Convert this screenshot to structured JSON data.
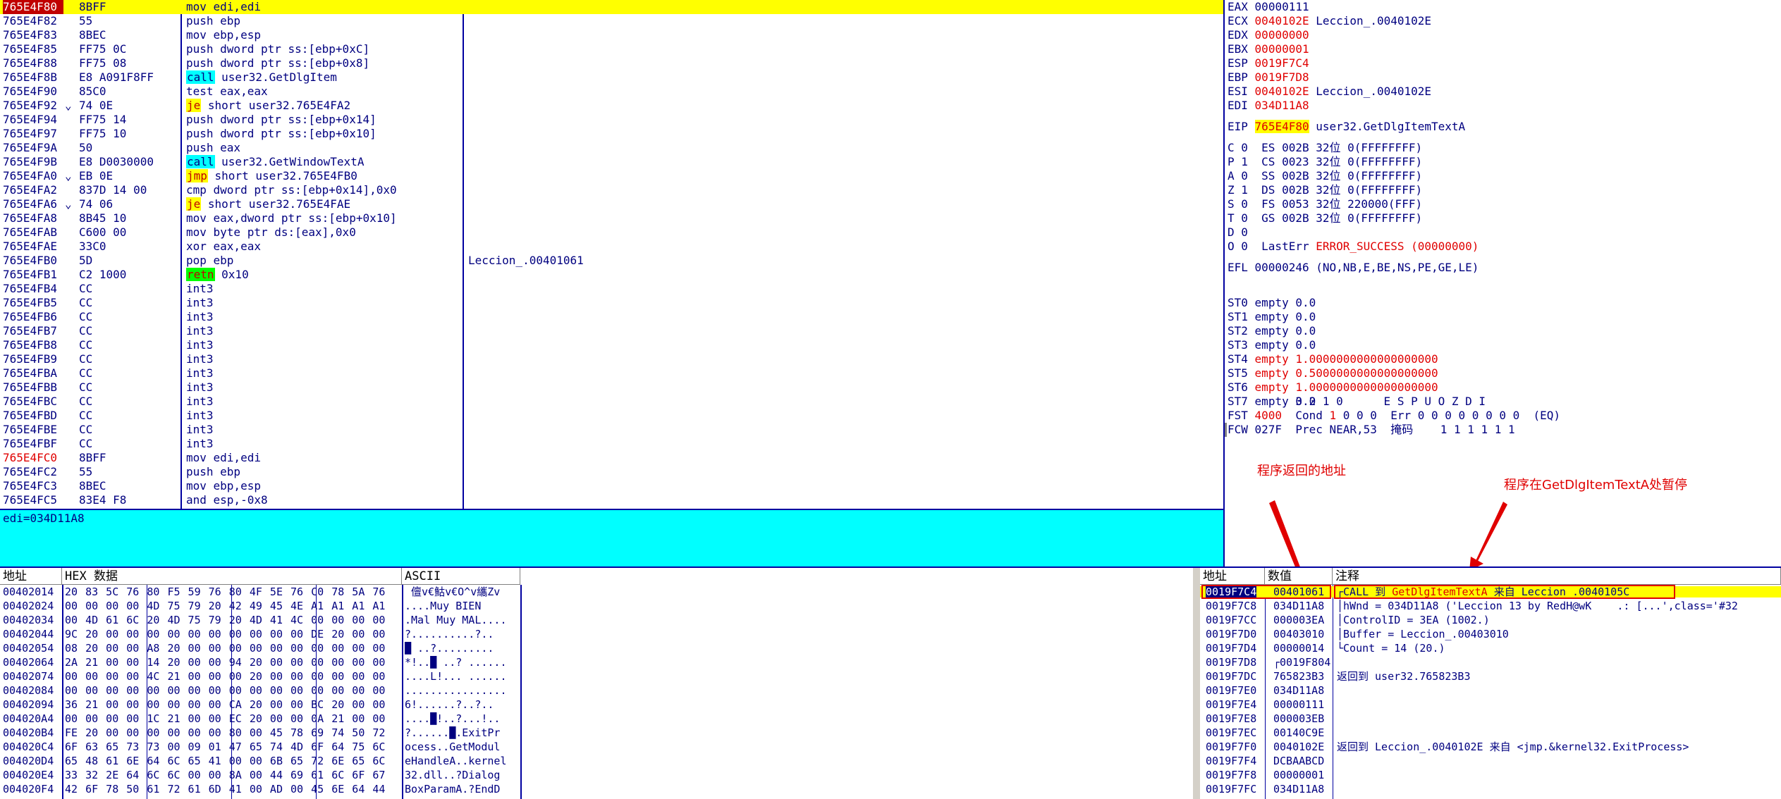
{
  "disasm": {
    "rows": [
      {
        "addr": "765E4F80",
        "arrow": "",
        "hex": "8BFF",
        "ins": "mov edi,edi",
        "kind": "",
        "cmt": "",
        "sel": true,
        "addr_style": "hl"
      },
      {
        "addr": "765E4F82",
        "arrow": "",
        "hex": "55",
        "ins": "push ebp",
        "kind": "",
        "cmt": ""
      },
      {
        "addr": "765E4F83",
        "arrow": "",
        "hex": "8BEC",
        "ins": "mov ebp,esp",
        "kind": "",
        "cmt": ""
      },
      {
        "addr": "765E4F85",
        "arrow": "",
        "hex": "FF75 0C",
        "ins": "push dword ptr ss:[ebp+0xC]",
        "kind": "",
        "cmt": ""
      },
      {
        "addr": "765E4F88",
        "arrow": "",
        "hex": "FF75 08",
        "ins": "push dword ptr ss:[ebp+0x8]",
        "kind": "",
        "cmt": ""
      },
      {
        "addr": "765E4F8B",
        "arrow": "",
        "hex": "E8 A091F8FF",
        "op": "call",
        "ins": " user32.GetDlgItem",
        "kind": "call",
        "cmt": ""
      },
      {
        "addr": "765E4F90",
        "arrow": "",
        "hex": "85C0",
        "ins": "test eax,eax",
        "kind": "",
        "cmt": ""
      },
      {
        "addr": "765E4F92",
        "arrow": "⌄",
        "hex": "74 0E",
        "op": "je",
        "ins": " short user32.765E4FA2",
        "kind": "jcc",
        "cmt": ""
      },
      {
        "addr": "765E4F94",
        "arrow": "",
        "hex": "FF75 14",
        "ins": "push dword ptr ss:[ebp+0x14]",
        "kind": "",
        "cmt": ""
      },
      {
        "addr": "765E4F97",
        "arrow": "",
        "hex": "FF75 10",
        "ins": "push dword ptr ss:[ebp+0x10]",
        "kind": "",
        "cmt": ""
      },
      {
        "addr": "765E4F9A",
        "arrow": "",
        "hex": "50",
        "ins": "push eax",
        "kind": "",
        "cmt": ""
      },
      {
        "addr": "765E4F9B",
        "arrow": "",
        "hex": "E8 D0030000",
        "op": "call",
        "ins": " user32.GetWindowTextA",
        "kind": "call",
        "cmt": ""
      },
      {
        "addr": "765E4FA0",
        "arrow": "⌄",
        "hex": "EB 0E",
        "op": "jmp",
        "ins": " short user32.765E4FB0",
        "kind": "jmp",
        "cmt": ""
      },
      {
        "addr": "765E4FA2",
        "arrow": "",
        "hex": "837D 14 00",
        "ins": "cmp dword ptr ss:[ebp+0x14],0x0",
        "kind": "",
        "cmt": ""
      },
      {
        "addr": "765E4FA6",
        "arrow": "⌄",
        "hex": "74 06",
        "op": "je",
        "ins": " short user32.765E4FAE",
        "kind": "jcc",
        "cmt": ""
      },
      {
        "addr": "765E4FA8",
        "arrow": "",
        "hex": "8B45 10",
        "ins": "mov eax,dword ptr ss:[ebp+0x10]",
        "kind": "",
        "cmt": ""
      },
      {
        "addr": "765E4FAB",
        "arrow": "",
        "hex": "C600 00",
        "ins": "mov byte ptr ds:[eax],0x0",
        "kind": "",
        "cmt": ""
      },
      {
        "addr": "765E4FAE",
        "arrow": "",
        "hex": "33C0",
        "ins": "xor eax,eax",
        "kind": "",
        "cmt": ""
      },
      {
        "addr": "765E4FB0",
        "arrow": "",
        "hex": "5D",
        "ins": "pop ebp",
        "kind": "",
        "cmt": "Leccion_.00401061"
      },
      {
        "addr": "765E4FB1",
        "arrow": "",
        "hex": "C2 1000",
        "op": "retn",
        "ins": " 0x10",
        "kind": "ret",
        "cmt": ""
      },
      {
        "addr": "765E4FB4",
        "arrow": "",
        "hex": "CC",
        "ins": "int3",
        "kind": "",
        "cmt": ""
      },
      {
        "addr": "765E4FB5",
        "arrow": "",
        "hex": "CC",
        "ins": "int3",
        "kind": "",
        "cmt": ""
      },
      {
        "addr": "765E4FB6",
        "arrow": "",
        "hex": "CC",
        "ins": "int3",
        "kind": "",
        "cmt": ""
      },
      {
        "addr": "765E4FB7",
        "arrow": "",
        "hex": "CC",
        "ins": "int3",
        "kind": "",
        "cmt": ""
      },
      {
        "addr": "765E4FB8",
        "arrow": "",
        "hex": "CC",
        "ins": "int3",
        "kind": "",
        "cmt": ""
      },
      {
        "addr": "765E4FB9",
        "arrow": "",
        "hex": "CC",
        "ins": "int3",
        "kind": "",
        "cmt": ""
      },
      {
        "addr": "765E4FBA",
        "arrow": "",
        "hex": "CC",
        "ins": "int3",
        "kind": "",
        "cmt": ""
      },
      {
        "addr": "765E4FBB",
        "arrow": "",
        "hex": "CC",
        "ins": "int3",
        "kind": "",
        "cmt": ""
      },
      {
        "addr": "765E4FBC",
        "arrow": "",
        "hex": "CC",
        "ins": "int3",
        "kind": "",
        "cmt": ""
      },
      {
        "addr": "765E4FBD",
        "arrow": "",
        "hex": "CC",
        "ins": "int3",
        "kind": "",
        "cmt": ""
      },
      {
        "addr": "765E4FBE",
        "arrow": "",
        "hex": "CC",
        "ins": "int3",
        "kind": "",
        "cmt": ""
      },
      {
        "addr": "765E4FBF",
        "arrow": "",
        "hex": "CC",
        "ins": "int3",
        "kind": "",
        "cmt": ""
      },
      {
        "addr": "765E4FC0",
        "arrow": "",
        "hex": "8BFF",
        "ins": "mov edi,edi",
        "kind": "",
        "cmt": "",
        "addr_style": "red"
      },
      {
        "addr": "765E4FC2",
        "arrow": "",
        "hex": "55",
        "ins": "push ebp",
        "kind": "",
        "cmt": ""
      },
      {
        "addr": "765E4FC3",
        "arrow": "",
        "hex": "8BEC",
        "ins": "mov ebp,esp",
        "kind": "",
        "cmt": ""
      },
      {
        "addr": "765E4FC5",
        "arrow": "",
        "hex": "83E4 F8",
        "ins": "and esp,-0x8",
        "kind": "",
        "cmt": ""
      }
    ]
  },
  "infobar": {
    "text": "edi=034D11A8"
  },
  "registers": {
    "gp": [
      {
        "name": "EAX",
        "value": "00000111",
        "cmt": "",
        "red": false
      },
      {
        "name": "ECX",
        "value": "0040102E",
        "cmt": "Leccion_.0040102E",
        "red": true
      },
      {
        "name": "EDX",
        "value": "00000000",
        "cmt": "",
        "red": true
      },
      {
        "name": "EBX",
        "value": "00000001",
        "cmt": "",
        "red": true
      },
      {
        "name": "ESP",
        "value": "0019F7C4",
        "cmt": "",
        "red": true
      },
      {
        "name": "EBP",
        "value": "0019F7D8",
        "cmt": "",
        "red": true
      },
      {
        "name": "ESI",
        "value": "0040102E",
        "cmt": "Leccion_.0040102E",
        "red": true
      },
      {
        "name": "EDI",
        "value": "034D11A8",
        "cmt": "",
        "red": true
      }
    ],
    "eip": {
      "name": "EIP",
      "value": "765E4F80",
      "cmt": "user32.GetDlgItemTextA"
    },
    "flags": [
      "C 0  ES 002B 32位 0(FFFFFFFF)",
      "P 1  CS 0023 32位 0(FFFFFFFF)",
      "A 0  SS 002B 32位 0(FFFFFFFF)",
      "Z 1  DS 002B 32位 0(FFFFFFFF)",
      "S 0  FS 0053 32位 220000(FFF)",
      "T 0  GS 002B 32位 0(FFFFFFFF)",
      "D 0"
    ],
    "lasterr_prefix": "O 0  LastErr ",
    "lasterr_value": "ERROR_SUCCESS (00000000)",
    "efl": "EFL 00000246 (NO,NB,E,BE,NS,PE,GE,LE)",
    "fpu": [
      {
        "name": "ST0",
        "val": "empty 0.0",
        "red": false
      },
      {
        "name": "ST1",
        "val": "empty 0.0",
        "red": false
      },
      {
        "name": "ST2",
        "val": "empty 0.0",
        "red": false
      },
      {
        "name": "ST3",
        "val": "empty 0.0",
        "red": false
      },
      {
        "name": "ST4",
        "val": "empty 1.0000000000000000000",
        "red": true
      },
      {
        "name": "ST5",
        "val": "empty 0.5000000000000000000",
        "red": true
      },
      {
        "name": "ST6",
        "val": "empty 1.0000000000000000000",
        "red": true
      },
      {
        "name": "ST7",
        "val": "empty 0.0",
        "red": false
      }
    ],
    "fpu_bits_header": "          3 2 1 0      E S P U O Z D I",
    "fst_prefix": "FST ",
    "fst_value": "4000",
    "fst_suffix": "  Cond ",
    "fst_cond_red": "1",
    "fst_rest": " 0 0 0  Err 0 0 0 0 0 0 0 0  (EQ)",
    "fcw": "FCW 027F  Prec NEAR,53  掩码    1 1 1 1 1 1"
  },
  "annotations": {
    "return_addr": "程序返回的地址",
    "paused_at": "程序在GetDlgItemTextA处暂停"
  },
  "dump": {
    "headers": {
      "addr": "地址",
      "hex": "HEX 数据",
      "ascii": "ASCII"
    },
    "rows": [
      {
        "addr": "00402014",
        "hex": "20 83 5C 76 80 F5 59 76 80 4F 5E 76 C0 78 5A 76",
        "ascii": " 儃v€鮕v€O^v纗Zv"
      },
      {
        "addr": "00402024",
        "hex": "00 00 00 00 4D 75 79 20 42 49 45 4E A1 A1 A1 A1",
        "ascii": "....Muy BIEN"
      },
      {
        "addr": "00402034",
        "hex": "00 4D 61 6C 20 4D 75 79 20 4D 41 4C 00 00 00 00",
        "ascii": ".Mal Muy MAL...."
      },
      {
        "addr": "00402044",
        "hex": "9C 20 00 00 00 00 00 00 00 00 00 00 DE 20 00 00",
        "ascii": "?..........?.."
      },
      {
        "addr": "00402054",
        "hex": "08 20 00 00 A8 20 00 00 00 00 00 00 00 00 00 00",
        "ascii": "█ ..?........."
      },
      {
        "addr": "00402064",
        "hex": "2A 21 00 00 14 20 00 00 94 20 00 00 00 00 00 00",
        "ascii": "*!..█ ..? ......"
      },
      {
        "addr": "00402074",
        "hex": "00 00 00 00 4C 21 00 00 00 20 00 00 00 00 00 00",
        "ascii": "....L!... ......"
      },
      {
        "addr": "00402084",
        "hex": "00 00 00 00 00 00 00 00 00 00 00 00 00 00 00 00",
        "ascii": "................"
      },
      {
        "addr": "00402094",
        "hex": "36 21 00 00 00 00 00 00 CA 20 00 00 BC 20 00 00",
        "ascii": "6!......?..?.."
      },
      {
        "addr": "004020A4",
        "hex": "00 00 00 00 1C 21 00 00 EC 20 00 00 0A 21 00 00",
        "ascii": "....█!..?...!.."
      },
      {
        "addr": "004020B4",
        "hex": "FE 20 00 00 00 00 00 00 80 00 45 78 69 74 50 72",
        "ascii": "?......█.ExitPr"
      },
      {
        "addr": "004020C4",
        "hex": "6F 63 65 73 73 00 09 01 47 65 74 4D 6F 64 75 6C",
        "ascii": "ocess..GetModul"
      },
      {
        "addr": "004020D4",
        "hex": "65 48 61 6E 64 6C 65 41 00 00 6B 65 72 6E 65 6C",
        "ascii": "eHandleA..kernel"
      },
      {
        "addr": "004020E4",
        "hex": "33 32 2E 64 6C 6C 00 00 8A 00 44 69 61 6C 6F 67",
        "ascii": "32.dll..?Dialog"
      },
      {
        "addr": "004020F4",
        "hex": "42 6F 78 50 61 72 61 6D 41 00 AD 00 45 6E 64 44",
        "ascii": "BoxParamA.?EndD"
      }
    ]
  },
  "stack": {
    "headers": {
      "addr": "地址",
      "val": "数值",
      "cmt": "注释"
    },
    "rows": [
      {
        "addr": "0019F7C4",
        "val": "00401061",
        "cmt": "┌CALL 到 ",
        "fn": "GetDlgItemTextA",
        "cmt2": " 来自 ",
        "src": "Leccion_.0040105C",
        "sel": true
      },
      {
        "addr": "0019F7C8",
        "val": "034D11A8",
        "cmt": "│hWnd = 034D11A8 ('Leccion 13 by RedH@wK    .: [...',class='#32"
      },
      {
        "addr": "0019F7CC",
        "val": "000003EA",
        "cmt": "│ControlID = 3EA (1002.)"
      },
      {
        "addr": "0019F7D0",
        "val": "00403010",
        "cmt": "│Buffer = Leccion_.00403010"
      },
      {
        "addr": "0019F7D4",
        "val": "00000014",
        "cmt": "└Count = 14 (20.)"
      },
      {
        "addr": "0019F7D8",
        "val": "┌0019F804",
        "cmt": ""
      },
      {
        "addr": "0019F7DC",
        "val": "765823B3",
        "cmt": "返回到 user32.765823B3"
      },
      {
        "addr": "0019F7E0",
        "val": "034D11A8",
        "cmt": ""
      },
      {
        "addr": "0019F7E4",
        "val": "00000111",
        "cmt": ""
      },
      {
        "addr": "0019F7E8",
        "val": "000003EB",
        "cmt": ""
      },
      {
        "addr": "0019F7EC",
        "val": "00140C9E",
        "cmt": ""
      },
      {
        "addr": "0019F7F0",
        "val": "0040102E",
        "cmt": "返回到 Leccion_.0040102E 来自 <jmp.&kernel32.ExitProcess>"
      },
      {
        "addr": "0019F7F4",
        "val": "DCBAABCD",
        "cmt": ""
      },
      {
        "addr": "0019F7F8",
        "val": "00000001",
        "cmt": ""
      },
      {
        "addr": "0019F7FC",
        "val": "034D11A8",
        "cmt": ""
      }
    ]
  },
  "colors": {
    "accent_red": "#e00000",
    "highlight_yellow": "#ffff00",
    "info_cyan": "#00ffff",
    "text_navy": "#000080"
  }
}
